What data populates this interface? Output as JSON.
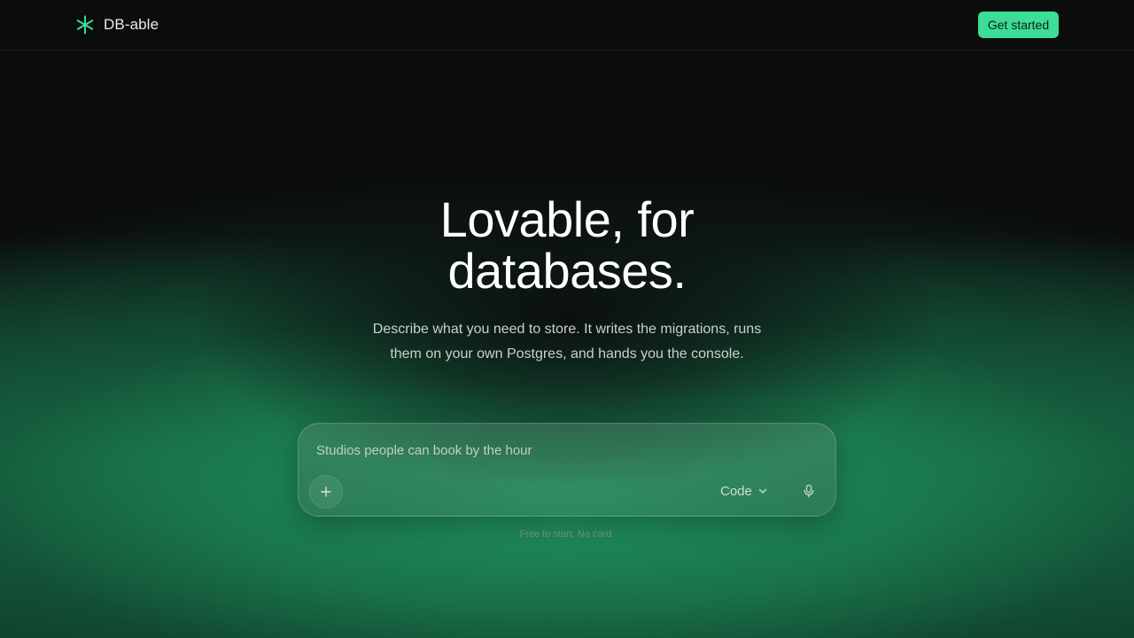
{
  "header": {
    "brand_name": "DB-able",
    "cta_label": "Get started",
    "brand_icon": "asterisk-icon",
    "accent_color": "#3ddc97"
  },
  "hero": {
    "title_line1": "Lovable, for",
    "title_line2": "databases.",
    "subtitle": "Describe what you need to store. It writes the migrations, runs them on your own Postgres, and hands you the console."
  },
  "prompt": {
    "placeholder": "Studios people can book by the hour",
    "add_icon": "plus-icon",
    "mode_label": "Code",
    "mode_icon": "chevron-down-icon",
    "mic_icon": "microphone-icon"
  },
  "footnote": "Free to start. No card."
}
